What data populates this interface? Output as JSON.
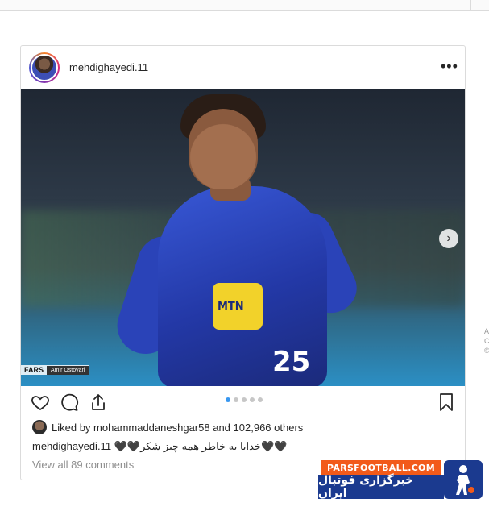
{
  "post": {
    "username": "mehdighayedi.11",
    "more_label": "•••",
    "photo": {
      "sponsor_text": "MTN",
      "shirt_number": "25",
      "watermark_logo": "FARS",
      "watermark_credit": "Amir Ostovari",
      "next_label": "›"
    },
    "carousel": {
      "count": 5,
      "active": 1
    },
    "likes": {
      "prefix": "Liked by",
      "liker": "mohammaddaneshgar58",
      "middle": "and",
      "count": "102,966 others"
    },
    "caption": {
      "user": "mehdighayedi.11",
      "text": "🖤🖤خدایا به خاطر همه چیز شکر🖤🖤"
    },
    "view_all_comments": "View all 89 comments"
  },
  "right_edge": [
    "A",
    "C",
    "©"
  ],
  "footer_logo": {
    "top": "PARSFOOTBALL.COM",
    "bottom": "خبرگزاری فوتبال ایران"
  },
  "colors": {
    "accent": "#3897f0",
    "border": "#dbdbdb",
    "logo_orange": "#f25a1a",
    "logo_blue": "#1b3a8f"
  },
  "icons": [
    "more-options-icon",
    "next-arrow-icon",
    "heart-icon",
    "comment-icon",
    "share-icon",
    "bookmark-icon"
  ]
}
